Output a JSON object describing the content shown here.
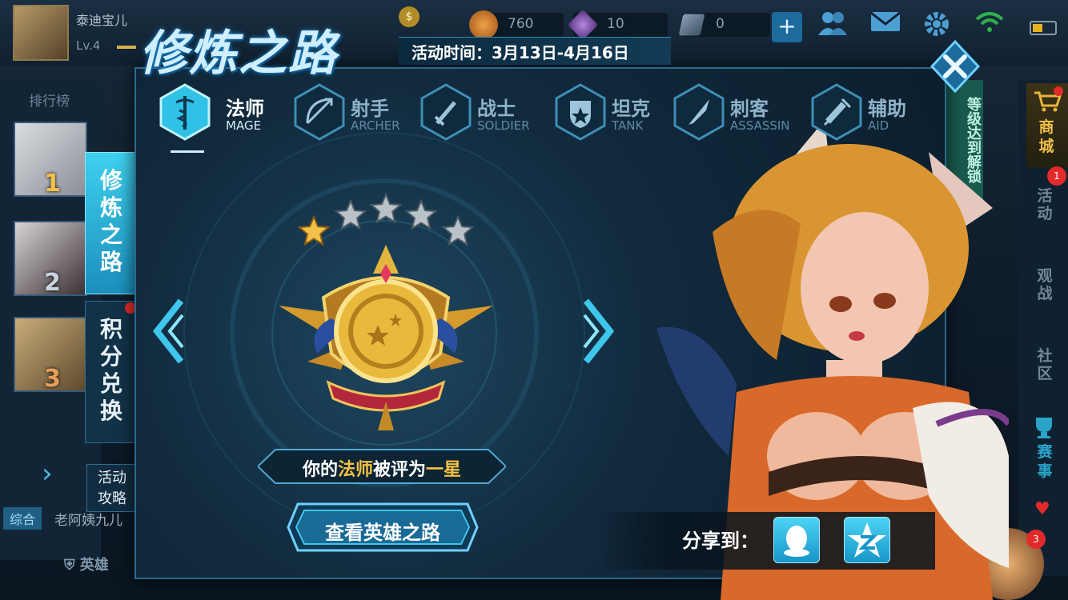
{
  "player": {
    "name": "泰迪宝儿",
    "level": "Lv.4"
  },
  "currencies": [
    {
      "name": "gold",
      "value": "760"
    },
    {
      "name": "diamond",
      "value": "10"
    },
    {
      "name": "coupon",
      "value": "0"
    }
  ],
  "event": {
    "title": "修炼之路",
    "time": "活动时间：3月13日-4月16日"
  },
  "left_panel": {
    "rank_title": "排行榜",
    "ranks": [
      "1",
      "2",
      "3"
    ],
    "side_tabs": [
      {
        "label": [
          "修",
          "炼",
          "之",
          "路"
        ]
      },
      {
        "label": [
          "积",
          "分",
          "兑",
          "换"
        ]
      }
    ],
    "guide_label_1": "活动",
    "guide_label_2": "攻略",
    "chat_tag": "综合",
    "chat_text": "老阿姨九儿",
    "hero_nav": "英雄"
  },
  "class_tabs": [
    {
      "cn": "法师",
      "en": "MAGE",
      "icon": "caduceus-icon",
      "active": true
    },
    {
      "cn": "射手",
      "en": "ARCHER",
      "icon": "bow-icon",
      "active": false
    },
    {
      "cn": "战士",
      "en": "SOLDIER",
      "icon": "sword-icon",
      "active": false
    },
    {
      "cn": "坦克",
      "en": "TANK",
      "icon": "shield-icon",
      "active": false
    },
    {
      "cn": "刺客",
      "en": "ASSASSIN",
      "icon": "dagger-icon",
      "active": false
    },
    {
      "cn": "辅助",
      "en": "AID",
      "icon": "syringe-icon",
      "active": false
    }
  ],
  "rating": {
    "stars_total": 5,
    "stars_earned": 1,
    "text_prefix": "你的",
    "text_class": "法师",
    "text_mid": "被评为",
    "text_rank": "一星"
  },
  "view_button": "查看英雄之路",
  "share": {
    "label": "分享到：",
    "targets": [
      "qq-icon",
      "qzone-icon"
    ]
  },
  "right_panel": {
    "shop": [
      "商",
      "城"
    ],
    "items": [
      {
        "label": [
          "活",
          "动"
        ],
        "badge": "1"
      },
      {
        "label": [
          "观",
          "战"
        ]
      },
      {
        "label": [
          "社",
          "区"
        ]
      },
      {
        "label": [
          "赛",
          "事"
        ]
      }
    ],
    "corner_badge": "3",
    "unlock_banner": "等级达到解锁"
  },
  "colors": {
    "accent": "#3fd0ee",
    "gold": "#f5c243",
    "badge_red": "#e22a2a"
  }
}
